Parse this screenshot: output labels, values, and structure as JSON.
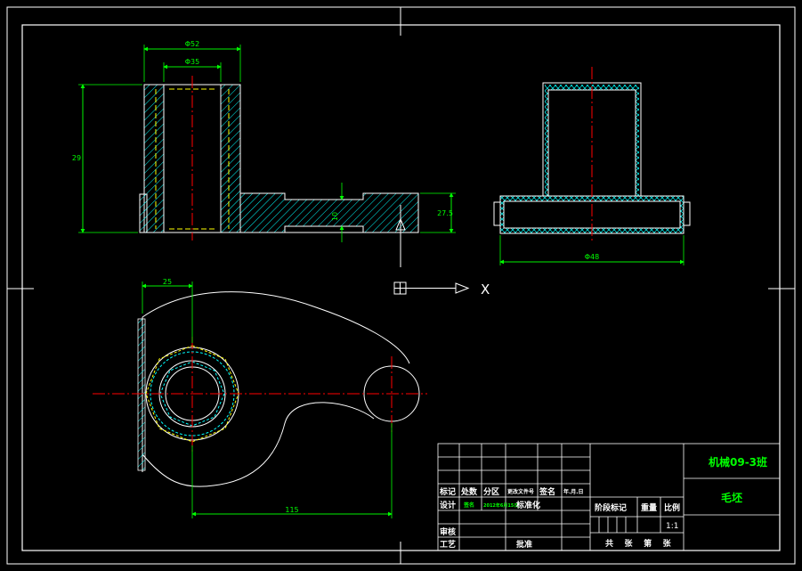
{
  "colors": {
    "background": "#000000",
    "outline": "#ffffff",
    "dimension": "#00ff00",
    "centerline": "#ff0000",
    "hatch": "#00ffff",
    "hidden": "#ffff00"
  },
  "dimensions": {
    "top_outer_width": "Φ52",
    "top_inner_width": "Φ35",
    "front_height": "29",
    "arm_thickness": "10",
    "arm_height": "27.5",
    "side_width": "Φ48",
    "plan_offset": "25",
    "plan_length": "115"
  },
  "ucs": {
    "x_label": "X"
  },
  "title_block": {
    "school_class": "机械09-3班",
    "part_name": "毛坯",
    "row_labels": {
      "mark": "标记",
      "count": "处数",
      "zone": "分区",
      "change_doc": "更改文件号",
      "signature": "签名",
      "date": "年.月.日",
      "design": "设计",
      "design_name": "签名",
      "design_date": "2012年6月15日",
      "standardize": "标准化",
      "review": "审核",
      "process": "工艺",
      "approve": "批准"
    },
    "stage_mark": "阶段标记",
    "weight": "重量",
    "scale_label": "比例",
    "scale_value": "1:1",
    "sheets": "共    张    第    张"
  }
}
